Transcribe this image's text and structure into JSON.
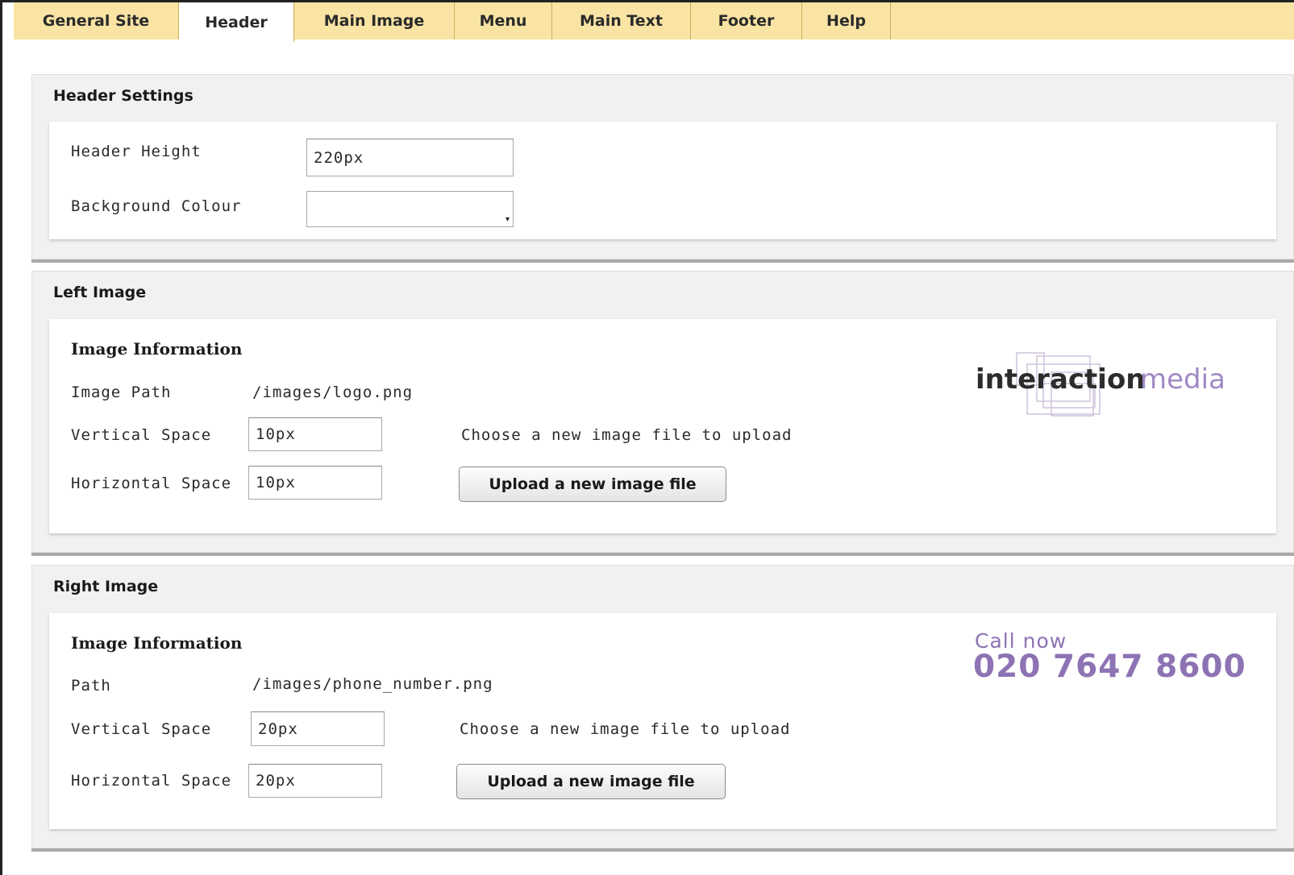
{
  "tabs": [
    {
      "label": "General Site"
    },
    {
      "label": "Header"
    },
    {
      "label": "Main Image"
    },
    {
      "label": "Menu"
    },
    {
      "label": "Main Text"
    },
    {
      "label": "Footer"
    },
    {
      "label": "Help"
    }
  ],
  "active_tab": "Header",
  "header_settings": {
    "title": "Header Settings",
    "height_label": "Header Height",
    "height_value": "220px",
    "bg_label": "Background Colour",
    "bg_value": ""
  },
  "left_image": {
    "title": "Left Image",
    "info_title": "Image Information",
    "path_label": "Image Path",
    "path_value": "/images/logo.png",
    "vspace_label": "Vertical Space",
    "vspace_value": "10px",
    "hspace_label": "Horizontal Space",
    "hspace_value": "10px",
    "upload_hint": "Choose a new image file to upload",
    "upload_button": "Upload a new image file",
    "preview_text_bold": "interaction",
    "preview_text_light": "media"
  },
  "right_image": {
    "title": "Right Image",
    "info_title": "Image Information",
    "path_label": "Path",
    "path_value": "/images/phone_number.png",
    "vspace_label": "Vertical Space",
    "vspace_value": "20px",
    "hspace_label": "Horizontal Space",
    "hspace_value": "20px",
    "upload_hint": "Choose a new image file to upload",
    "upload_button": "Upload a new image file",
    "preview_line1": "Call now",
    "preview_line2": "020 7647 8600"
  },
  "colors": {
    "tab_bar": "#f9e4a4",
    "panel_bg": "#f1f1f1",
    "brand_purple": "#8d73b4"
  }
}
